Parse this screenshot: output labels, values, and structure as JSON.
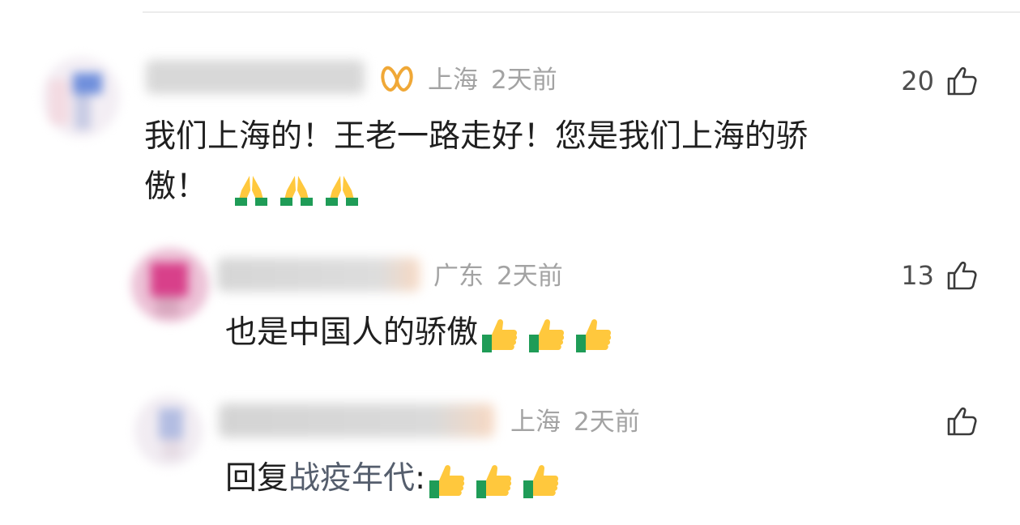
{
  "comments": [
    {
      "location": "上海",
      "time": "2天前",
      "likes": "20",
      "line1": "我们上海的！王老一路走好！您是我们上海的骄",
      "line2": "傲！",
      "emoji": "pray-emoji",
      "emoji_count": 3,
      "badge": "vip-badge-icon"
    },
    {
      "location": "广东",
      "time": "2天前",
      "likes": "13",
      "text": "也是中国人的骄傲",
      "emoji": "thumbs-up-emoji",
      "emoji_count": 3
    },
    {
      "location": "上海",
      "time": "2天前",
      "likes": "",
      "text_prefix": "回复",
      "mention": "战疫年代",
      "text_suffix": ":",
      "emoji": "thumbs-up-emoji",
      "emoji_count": 3
    }
  ]
}
